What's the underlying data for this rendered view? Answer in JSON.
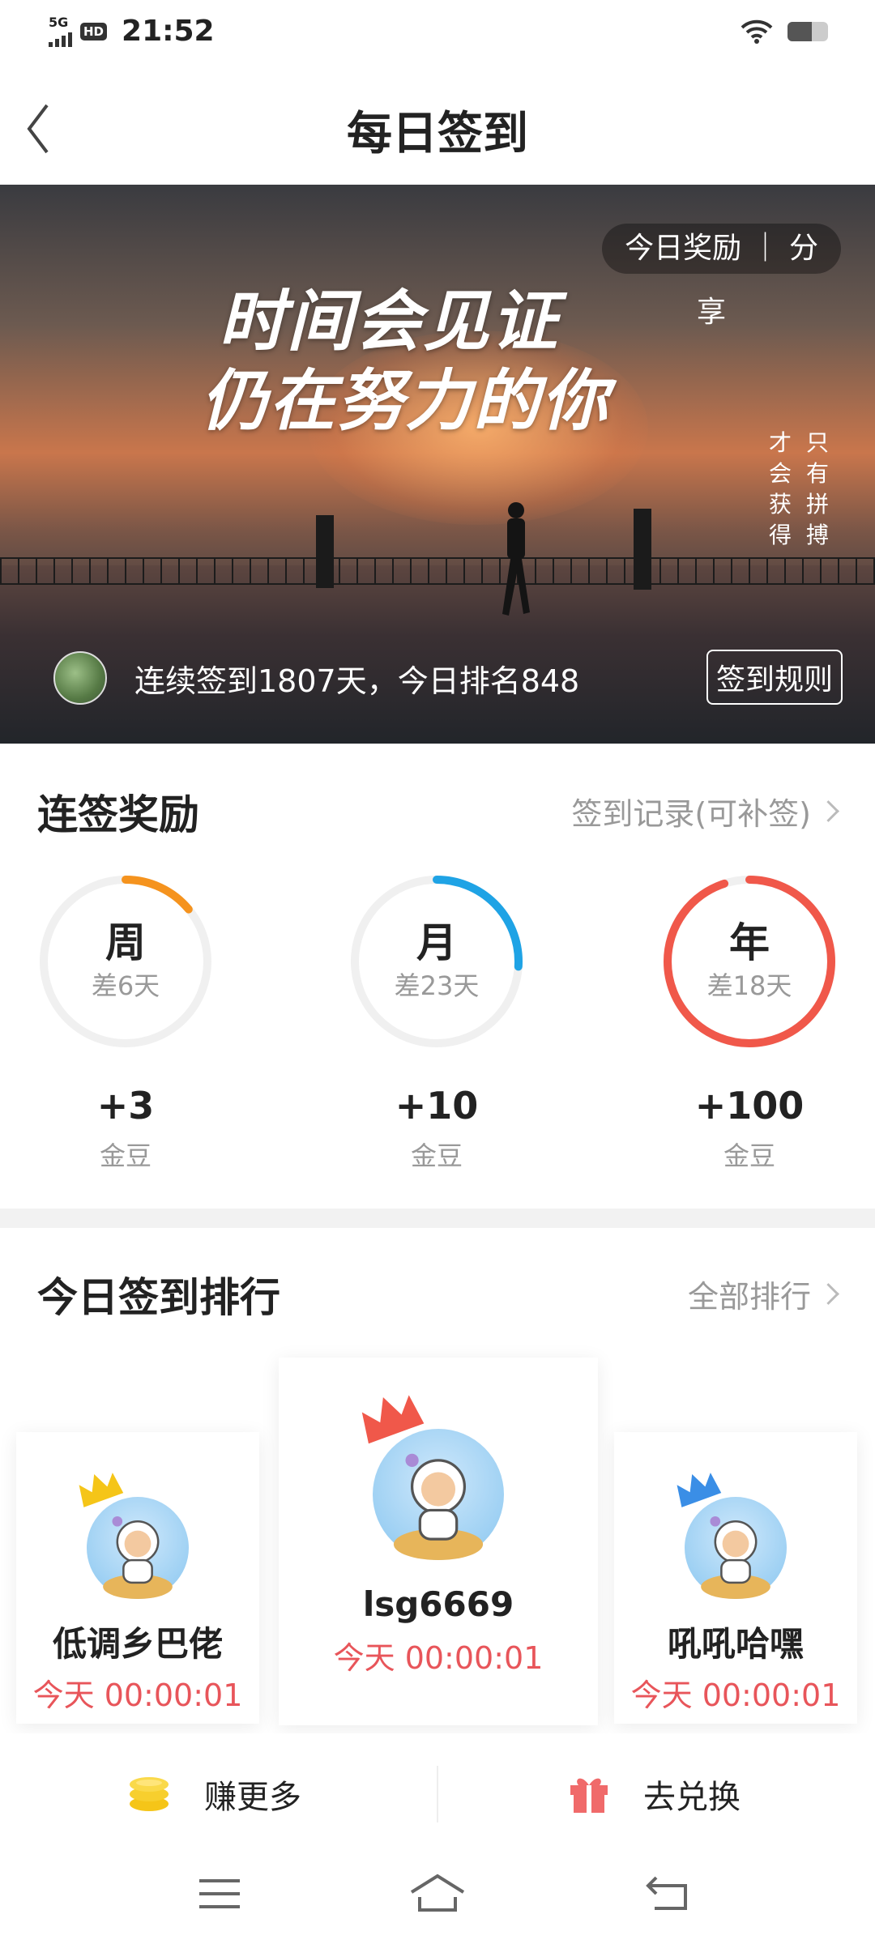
{
  "status_bar": {
    "network": "5G",
    "hd": "HD",
    "time": "21:52",
    "battery_level": 0.6
  },
  "header": {
    "title": "每日签到"
  },
  "banner": {
    "slogan_line1": "时间会见证",
    "slogan_line2": "仍在努力的你",
    "vertical_col1": "只有拼搏",
    "vertical_col2": "才会获得",
    "reward_share": "今日奖励 ｜ 分",
    "share_tail": "享",
    "streak_text": "连续签到1807天，今日排名848",
    "rules_label": "签到规则"
  },
  "streak_rewards": {
    "title": "连签奖励",
    "record_link": "签到记录(可补签)",
    "items": [
      {
        "label": "周",
        "remaining": "差6天",
        "points": "+3",
        "unit": "金豆",
        "progress": 0.14,
        "color": "#f5931e"
      },
      {
        "label": "月",
        "remaining": "差23天",
        "points": "+10",
        "unit": "金豆",
        "progress": 0.26,
        "color": "#1fa3e5"
      },
      {
        "label": "年",
        "remaining": "差18天",
        "points": "+100",
        "unit": "金豆",
        "progress": 0.95,
        "color": "#f0584a"
      }
    ]
  },
  "ranking": {
    "title": "今日签到排行",
    "all_link": "全部排行",
    "top3": [
      {
        "rank": 2,
        "name": "低调乡巴佬",
        "time": "今天 00:00:01",
        "crown_color": "#f5c518"
      },
      {
        "rank": 1,
        "name": "lsg6669",
        "time": "今天 00:00:01",
        "crown_color": "#f0584a"
      },
      {
        "rank": 3,
        "name": "吼吼哈嘿",
        "time": "今天 00:00:01",
        "crown_color": "#3a8ee6"
      }
    ]
  },
  "bottom_actions": {
    "earn_more": "赚更多",
    "redeem": "去兑换"
  },
  "colors": {
    "accent_red": "#e8555a",
    "gold": "#f5c518",
    "gift": "#f06a6a"
  }
}
